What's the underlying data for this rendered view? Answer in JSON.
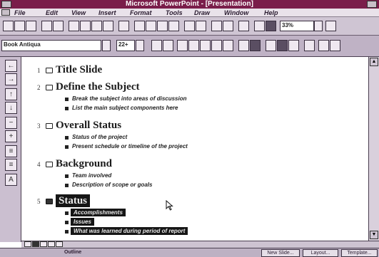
{
  "window": {
    "title": "Microsoft PowerPoint - [Presentation]"
  },
  "menu": [
    "File",
    "Edit",
    "View",
    "Insert",
    "Format",
    "Tools",
    "Draw",
    "Window",
    "Help"
  ],
  "toolbar": {
    "zoom_value": "33%",
    "font_name": "Book Antiqua",
    "font_size": "22+"
  },
  "outline": {
    "slides": [
      {
        "number": "1",
        "title": "Title Slide",
        "bullets": []
      },
      {
        "number": "2",
        "title": "Define the Subject",
        "bullets": [
          "Break the subject into areas of discussion",
          "List the main subject components here"
        ]
      },
      {
        "number": "3",
        "title": "Overall Status",
        "bullets": [
          "Status of the project",
          "Present schedule or timeline of the project"
        ]
      },
      {
        "number": "4",
        "title": "Background",
        "bullets": [
          "Team involved",
          "Description of scope or goals"
        ]
      },
      {
        "number": "5",
        "title": "Status",
        "bullets": [
          "Accomplishments",
          "Issues",
          "What was learned during period of report"
        ]
      }
    ]
  },
  "status": {
    "view": "Outline",
    "new_slide": "New Slide...",
    "layout": "Layout...",
    "template": "Template..."
  }
}
